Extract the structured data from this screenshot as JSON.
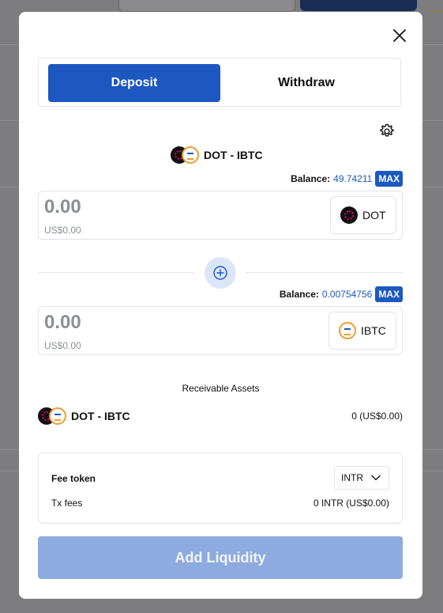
{
  "modal": {
    "close_label": "×",
    "tabs": [
      {
        "label": "Deposit",
        "active": true
      },
      {
        "label": "Withdraw",
        "active": false
      }
    ],
    "pair": "DOT - IBTC",
    "deposit_a": {
      "balance_label": "Balance:",
      "balance_value": "49.74211",
      "max_label": "MAX",
      "placeholder": "0.00",
      "usd": "US$0.00",
      "token": "DOT"
    },
    "deposit_b": {
      "balance_label": "Balance:",
      "balance_value": "0.00754756",
      "max_label": "MAX",
      "placeholder": "0.00",
      "usd": "US$0.00",
      "token": "IBTC"
    },
    "receivable": {
      "title": "Receivable Assets",
      "pair": "DOT - IBTC",
      "value": "0 (US$0.00)"
    },
    "fees": {
      "fee_token_label": "Fee token",
      "fee_token_value": "INTR",
      "tx_fees_label": "Tx fees",
      "tx_fees_value": "0 INTR (US$0.00)"
    },
    "submit_label": "Add Liquidity"
  },
  "colors": {
    "primary": "#1d58c1",
    "disabled_button": "#8eabdf",
    "dot_pink": "#e6007a",
    "ibtc_orange": "#f29a2e"
  },
  "icons": [
    "close-icon",
    "settings-gear-icon",
    "dot-token-icon",
    "ibtc-token-icon",
    "plus-circle-icon",
    "chevron-down-icon"
  ]
}
